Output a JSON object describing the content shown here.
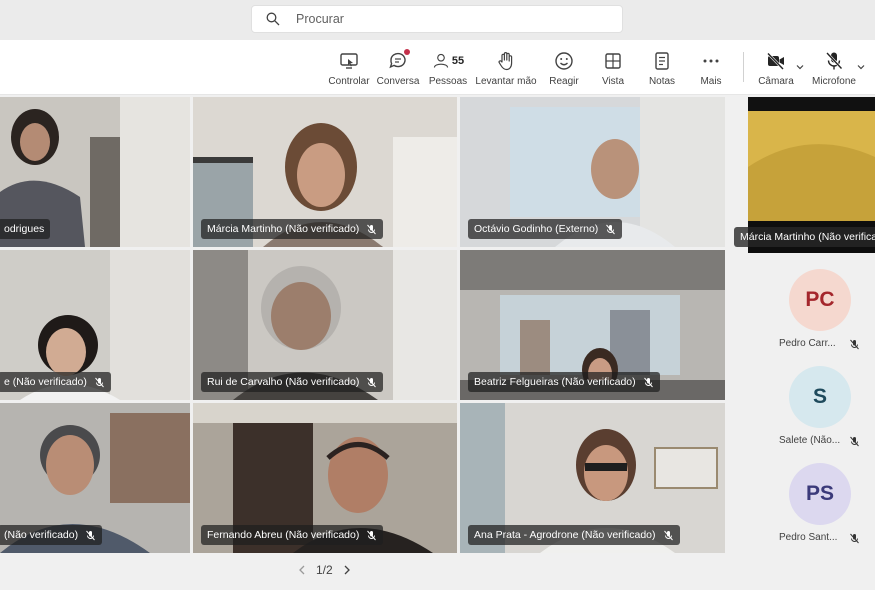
{
  "search": {
    "placeholder": "Procurar"
  },
  "toolbar": {
    "controlar": "Controlar",
    "conversa": "Conversa",
    "pessoas": "Pessoas",
    "people_count": "55",
    "levantar": "Levantar mão",
    "reagir": "Reagir",
    "vista": "Vista",
    "notas": "Notas",
    "mais": "Mais",
    "camara": "Câmara",
    "microfone": "Microfone"
  },
  "tiles": [
    {
      "name": "odrigues"
    },
    {
      "name": "Márcia Martinho (Não verificado)"
    },
    {
      "name": "Octávio Godinho (Externo)"
    },
    {
      "name": "e (Não verificado)"
    },
    {
      "name": "Rui de Carvalho (Não verificado)"
    },
    {
      "name": "Beatriz Felgueiras (Não verificado)"
    },
    {
      "name": "(Não verificado)"
    },
    {
      "name": "Fernando Abreu (Não verificado)"
    },
    {
      "name": "Ana Prata - Agrodrone (Não verificado)"
    }
  ],
  "pager": {
    "label": "1/2"
  },
  "sidebar": {
    "featured": "Márcia Martinho (Não verificado)",
    "participants": [
      {
        "initials": "PC",
        "name": "Pedro Carr...",
        "color": "#f5d8cf",
        "text_color": "#a4262c"
      },
      {
        "initials": "S",
        "name": "Salete (Não...",
        "color": "#d6e8ee",
        "text_color": "#1e4a5c"
      },
      {
        "initials": "PS",
        "name": "Pedro Sant...",
        "color": "#dcd8ef",
        "text_color": "#3b3a7a"
      }
    ]
  }
}
